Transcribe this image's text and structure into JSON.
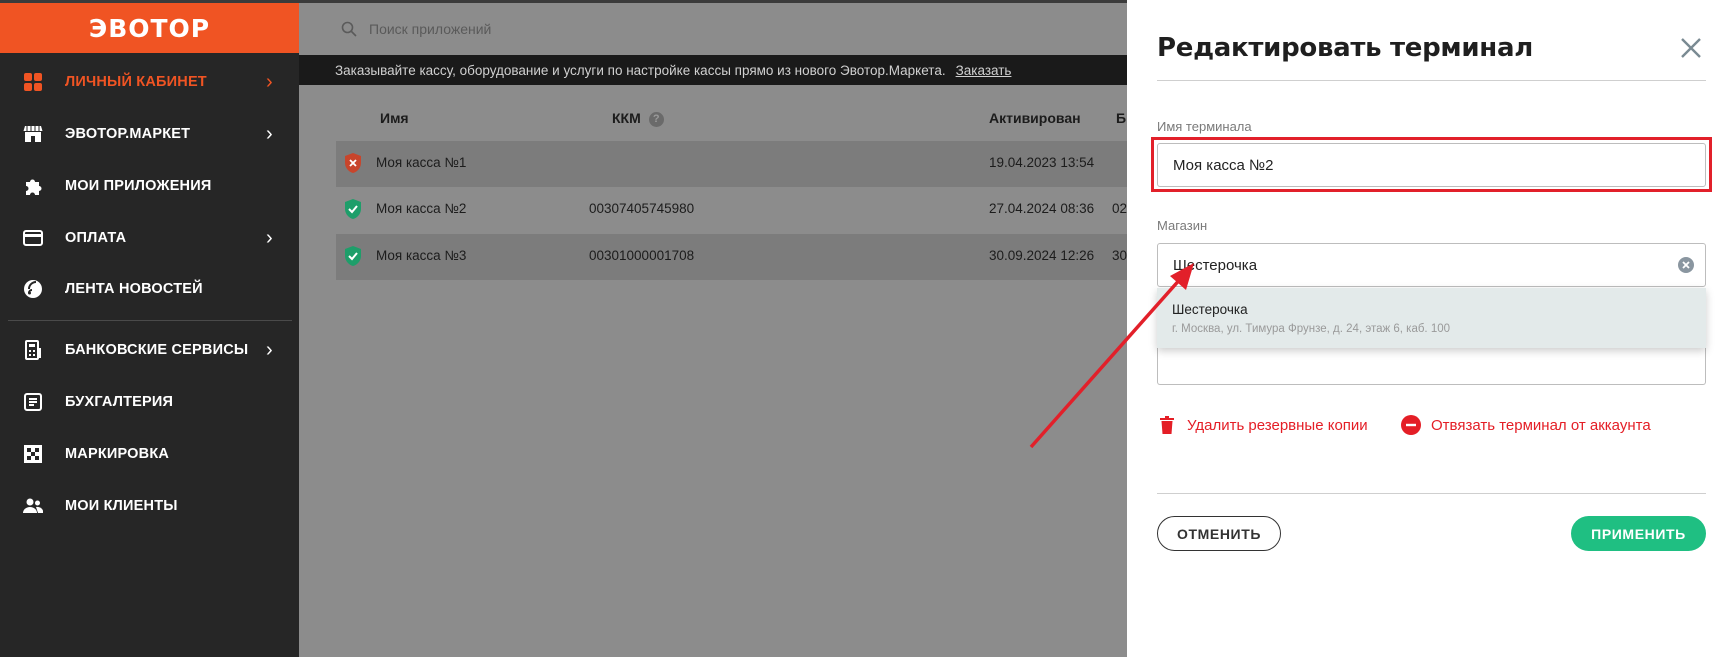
{
  "brand": {
    "logo_text": "ЭВОТОР",
    "accent": "#f05423"
  },
  "sidebar": {
    "items": [
      {
        "label": "ЛИЧНЫЙ КАБИНЕТ",
        "icon": "dashboard-grid-icon",
        "has_chevron": true,
        "active": true
      },
      {
        "label": "ЭВОТОР.МАРКЕТ",
        "icon": "store-icon",
        "has_chevron": true
      },
      {
        "label": "МОИ ПРИЛОЖЕНИЯ",
        "icon": "puzzle-icon",
        "has_chevron": false
      },
      {
        "label": "ОПЛАТА",
        "icon": "card-icon",
        "has_chevron": true
      },
      {
        "label": "ЛЕНТА НОВОСТЕЙ",
        "icon": "news-icon",
        "has_chevron": false
      },
      {
        "label": "БАНКОВСКИЕ СЕРВИСЫ",
        "icon": "bank-icon",
        "has_chevron": true
      },
      {
        "label": "БУХГАЛТЕРИЯ",
        "icon": "accounting-icon",
        "has_chevron": false
      },
      {
        "label": "МАРКИРОВКА",
        "icon": "checkered-icon",
        "has_chevron": false
      },
      {
        "label": "МОИ КЛИЕНТЫ",
        "icon": "clients-icon",
        "has_chevron": false
      }
    ],
    "chevron": "›"
  },
  "main": {
    "search_placeholder": "Поиск приложений",
    "banner": {
      "text": "Заказывайте кассу, оборудование и услуги по настройке кассы прямо из нового Эвотор.Маркета.",
      "link": "Заказать"
    },
    "table": {
      "headers": [
        "Имя",
        "ККМ",
        "Активирован",
        "Б"
      ],
      "rows": [
        {
          "status": "error",
          "name": "Моя касса №1",
          "kkm": "",
          "activated": "19.04.2023 13:54",
          "extra": ""
        },
        {
          "status": "ok",
          "name": "Моя касса №2",
          "kkm": "00307405745980",
          "activated": "27.04.2024 08:36",
          "extra": "02"
        },
        {
          "status": "ok",
          "name": "Моя касса №3",
          "kkm": "00301000001708",
          "activated": "30.09.2024 12:26",
          "extra": "30"
        }
      ]
    }
  },
  "drawer": {
    "title": "Редактировать терминал",
    "name_label": "Имя терминала",
    "name_value": "Моя касса №2",
    "store_label": "Магазин",
    "store_value": "Шестерочка",
    "dropdown": {
      "name": "Шестерочка",
      "address": "г. Москва, ул. Тимура Фрунзе, д. 24, этаж 6, каб. 100"
    },
    "delete_backups": "Удалить резервные копии",
    "unlink_terminal": "Отвязать терминал от аккаунта",
    "cancel_label": "ОТМЕНИТЬ",
    "apply_label": "ПРИМЕНИТЬ"
  },
  "colors": {
    "danger": "#e41e26",
    "success": "#1fbf82",
    "annotation": "#e2202a",
    "shield_ok": "#1e9e6a",
    "shield_err": "#c8452c"
  }
}
